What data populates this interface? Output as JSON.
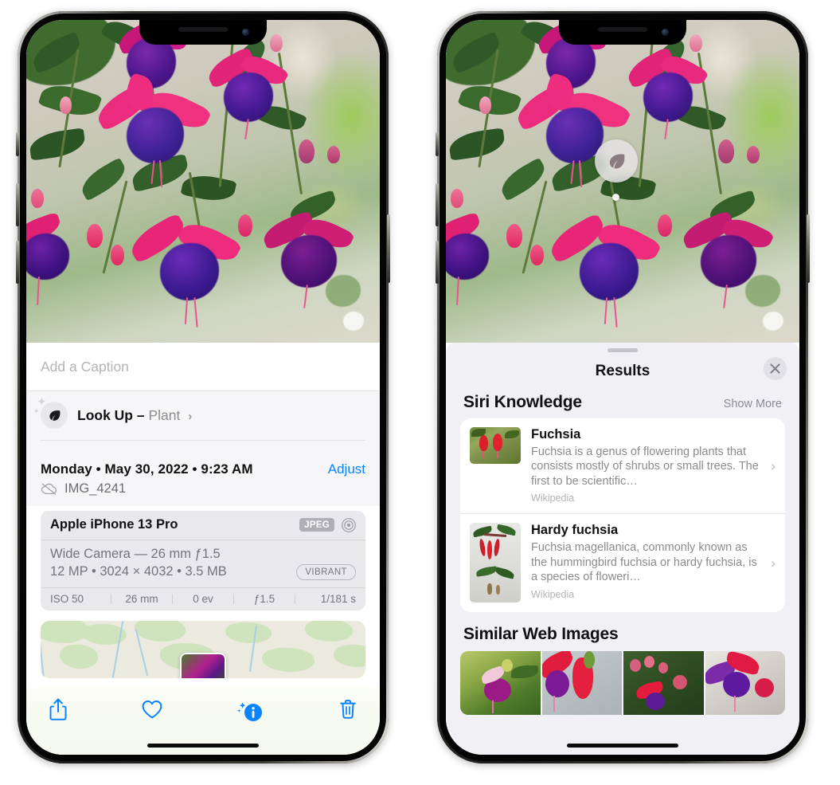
{
  "left_phone": {
    "name": "photos-detail-phone",
    "caption": {
      "placeholder": "Add a Caption",
      "value": ""
    },
    "lookup": {
      "icon": "leaf-icon",
      "label": "Look Up –",
      "subject": "Plant",
      "chevron": "›"
    },
    "meta": {
      "date": "Monday • May 30, 2022 • 9:23 AM",
      "adjust_label": "Adjust",
      "cloud_icon": "cloud-slash-icon",
      "filename": "IMG_4241"
    },
    "exif": {
      "device": "Apple iPhone 13 Pro",
      "format_badge": "JPEG",
      "aperture_icon": "aperture-icon",
      "lens_line": "Wide Camera — 26 mm ƒ1.5",
      "size_line": "12 MP • 3024 × 4032 • 3.5 MB",
      "style_badge": "VIBRANT",
      "stats": [
        "ISO 50",
        "26 mm",
        "0 ev",
        "ƒ1.5",
        "1/181 s"
      ]
    },
    "map": {
      "name": "location-map-thumbnail"
    },
    "toolbar": {
      "items": [
        {
          "icon": "share-icon",
          "name": "share-button"
        },
        {
          "icon": "heart-icon",
          "name": "favorite-button"
        },
        {
          "icon": "info-sparkle-icon",
          "name": "info-button"
        },
        {
          "icon": "trash-icon",
          "name": "delete-button"
        }
      ]
    }
  },
  "right_phone": {
    "name": "visual-lookup-results-phone",
    "photo_badge": {
      "icon": "leaf-icon",
      "name": "visual-lookup-badge"
    },
    "sheet": {
      "title": "Results",
      "close_icon": "close-icon",
      "siri_knowledge": {
        "heading": "Siri Knowledge",
        "action": "Show More",
        "cards": [
          {
            "title": "Fuchsia",
            "description": "Fuchsia is a genus of flowering plants that consists mostly of shrubs or small trees. The first to be scientific…",
            "source": "Wikipedia",
            "chevron": "›"
          },
          {
            "title": "Hardy fuchsia",
            "description": "Fuchsia magellanica, commonly known as the hummingbird fuchsia or hardy fuchsia, is a species of floweri…",
            "source": "Wikipedia",
            "chevron": "›"
          }
        ]
      },
      "similar_web_images": {
        "heading": "Similar Web Images",
        "count": 4
      }
    }
  },
  "colors": {
    "accent_blue": "#0a84ff",
    "sheet_gray": "#f1f1f5",
    "exif_gray": "#e8e8ed",
    "label_gray": "#8a8a90"
  }
}
